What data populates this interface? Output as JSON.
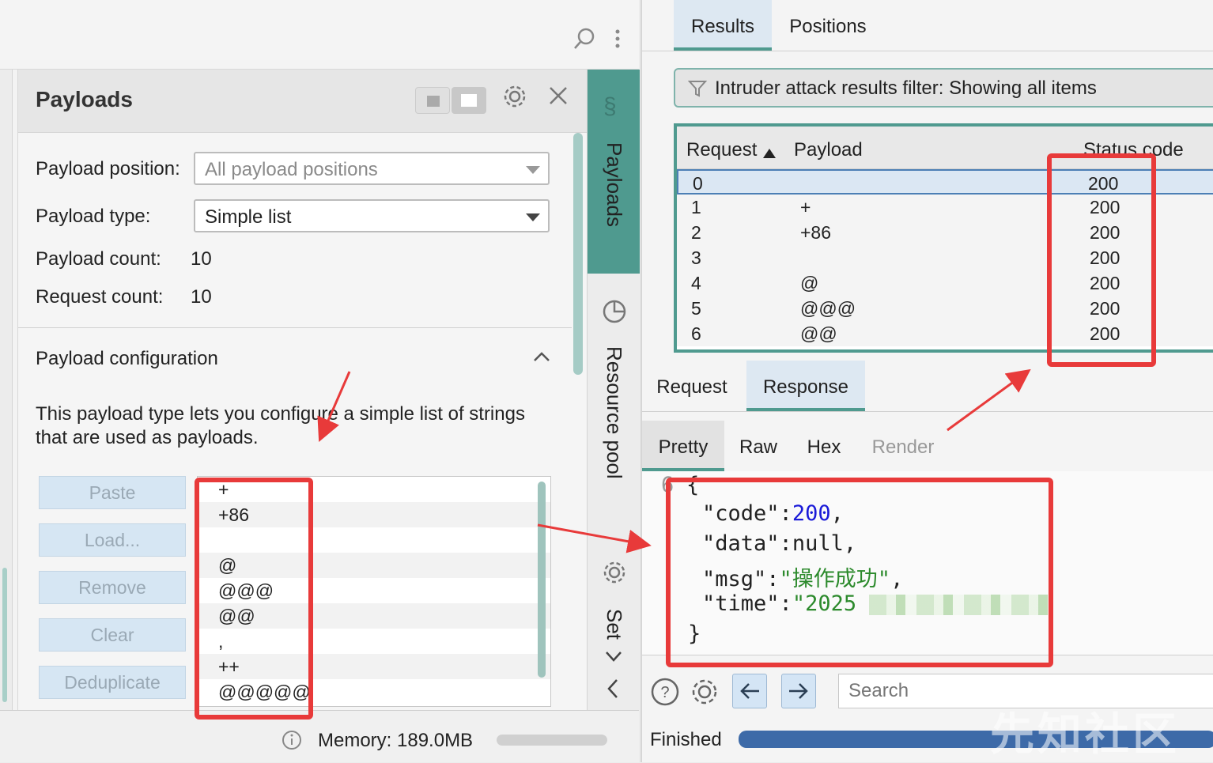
{
  "left": {
    "panel_title": "Payloads",
    "fields": {
      "position_label": "Payload position:",
      "position_value": "All payload positions",
      "type_label": "Payload type:",
      "type_value": "Simple list",
      "count_label": "Payload count:",
      "count_value": "10",
      "request_label": "Request count:",
      "request_value": "10"
    },
    "config": {
      "title": "Payload configuration",
      "description_1": "This payload type lets you configure a simple list of strings",
      "description_2": "that are used as payloads."
    },
    "buttons": {
      "paste": "Paste",
      "load": "Load...",
      "remove": "Remove",
      "clear": "Clear",
      "deduplicate": "Deduplicate"
    },
    "payload_list": [
      "+",
      "+86",
      "",
      "@",
      "@@@",
      "@@",
      ",",
      "++",
      "@@@@@"
    ],
    "vertical_tabs": {
      "payloads": "Payloads",
      "resource_pool": "Resource pool",
      "settings": "Set"
    },
    "status": {
      "memory": "Memory: 189.0MB"
    }
  },
  "right": {
    "tabs": {
      "results": "Results",
      "positions": "Positions"
    },
    "filter": "Intruder attack results filter: Showing all items",
    "table": {
      "headers": {
        "request": "Request",
        "payload": "Payload",
        "status": "Status code"
      },
      "rows": [
        {
          "request": "0",
          "payload": "",
          "status": "200"
        },
        {
          "request": "1",
          "payload": "+",
          "status": "200"
        },
        {
          "request": "2",
          "payload": "+86",
          "status": "200"
        },
        {
          "request": "3",
          "payload": "",
          "status": "200"
        },
        {
          "request": "4",
          "payload": "@",
          "status": "200"
        },
        {
          "request": "5",
          "payload": "@@@",
          "status": "200"
        },
        {
          "request": "6",
          "payload": "@@",
          "status": "200"
        }
      ]
    },
    "msg_tabs": {
      "request": "Request",
      "response": "Response"
    },
    "view_tabs": {
      "pretty": "Pretty",
      "raw": "Raw",
      "hex": "Hex",
      "render": "Render"
    },
    "code": {
      "line_number": "6",
      "open": "{",
      "code_key": "\"code\"",
      "code_val": "200",
      "data_key": "\"data\"",
      "data_val": "null",
      "msg_key": "\"msg\"",
      "msg_val": "\"操作成功\"",
      "time_key": "\"time\"",
      "time_val": "\"2025",
      "close": "}"
    },
    "search_placeholder": "Search",
    "status_text": "Finished",
    "watermark": "先知社区"
  },
  "colors": {
    "accent_teal": "#4f9a8f",
    "annotation_red": "#e83a3a",
    "json_number": "#1a1ad8",
    "json_string": "#2c8a2c"
  }
}
